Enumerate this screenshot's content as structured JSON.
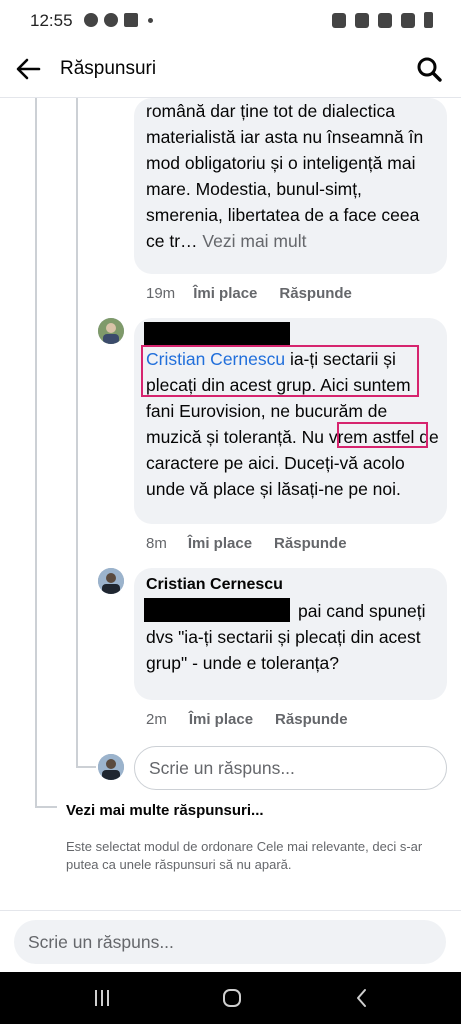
{
  "status_bar": {
    "time": "12:55"
  },
  "header": {
    "title": "Răspunsuri"
  },
  "comments": [
    {
      "body": "română dar ține tot de dialectica materialistă iar asta nu înseamnă în mod obligatoriu și o inteligență mai mare. Modestia, bunul-simț, smerenia, libertatea de a face ceea ce tr…",
      "see_more": "Vezi mai mult",
      "time": "19m",
      "like": "Îmi place",
      "reply": "Răspunde"
    },
    {
      "mention": "Cristian Cernescu",
      "body_before": " ia-ți sectarii și plecați din acest grup. Aici suntem fani Eurovision, ne bucurăm de muzică și ",
      "highlight_word": "toleranță.",
      "body_after": " Nu vrem astfel de caractere pe aici. Duceți-vă acolo unde vă place și lăsați-ne pe noi.",
      "time": "8m",
      "like": "Îmi place",
      "reply": "Răspunde"
    },
    {
      "author": "Cristian Cernescu",
      "body": "pai cand spuneți dvs \"ia-ți sectarii și plecați din acest grup\" - unde e toleranța?",
      "time": "2m",
      "like": "Îmi place",
      "reply": "Răspunde"
    }
  ],
  "reply_input": {
    "placeholder": "Scrie un răspuns..."
  },
  "more_replies": "Vezi mai multe răspunsuri...",
  "sort_note": "Este selectat modul de ordonare Cele mai relevante, deci s-ar putea ca unele răspunsuri să nu apară.",
  "main_input": {
    "placeholder": "Scrie un răspuns..."
  },
  "colors": {
    "link": "#216fdb",
    "highlight_box": "#d6246e",
    "bubble": "#f0f2f5"
  },
  "icons": [
    "back-arrow-icon",
    "search-icon",
    "recents-icon",
    "home-icon",
    "back-nav-icon"
  ]
}
